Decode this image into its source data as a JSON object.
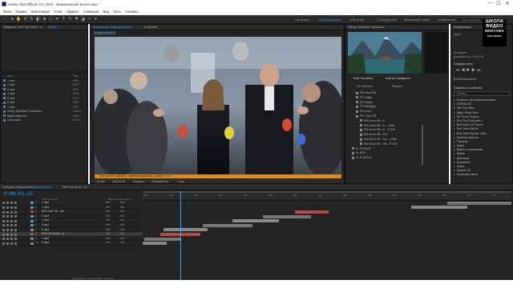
{
  "window": {
    "title": "Adobe After Effects CC 2018 - Безымянный проект.aep *",
    "controls": [
      "—",
      "☐",
      "✕"
    ]
  },
  "menu": [
    "Файл",
    "Правка",
    "Композиция",
    "Слой",
    "Эффект",
    "Анимация",
    "Вид",
    "Окно",
    "Справка"
  ],
  "toolbar": {
    "snap_label": "Привязка",
    "workspaces": [
      "По умолчанию",
      "Обучение",
      "Стандартный",
      "Маленький экран",
      "Библиотеки"
    ],
    "search_placeholder": "Поиск справки"
  },
  "project_panel": {
    "tab_effects": "Эффекты: Dist Pow Zoom - in",
    "tab_project": "Проект",
    "col_name": "Имя",
    "col_type": "Тип",
    "items": [
      {
        "name": "1.mp4",
        "type": "MP4"
      },
      {
        "name": "2.mp4",
        "type": "MP4"
      },
      {
        "name": "3.mp4",
        "type": "MP4"
      },
      {
        "name": "4.mp4",
        "type": "MP4"
      },
      {
        "name": "5.mp4",
        "type": "MP4"
      },
      {
        "name": "6.mp4",
        "type": "MP4"
      },
      {
        "name": "7.mp4",
        "type": "MP4"
      },
      {
        "name": "Handy Seamless Transitions",
        "type": "Папка"
      },
      {
        "name": "Видеоэффекты",
        "type": "Комп."
      },
      {
        "name": "Сплошные",
        "type": "Папка"
      }
    ]
  },
  "viewer": {
    "tab_comp": "Композиция: Видеоэффекты",
    "tab_layer": "Слой (нет)",
    "comp_label": "Видеоэффекты",
    "warning": "Этот проект содержит ошибки выражений: ошибка 1 из 1",
    "zoom": "49,9%",
    "timecode": "0:00:01:15",
    "quality": "Четверть",
    "camera": "Активная ка...",
    "views": "1 вид"
  },
  "extension_panel": {
    "title": "Handy Seamless Transitions",
    "add_transition": "Add Transition",
    "add_by_categories": "Add by Categories",
    "col_no_selected": "No Selected",
    "col_random": "Random",
    "tree": [
      {
        "label": "PR Long Roll",
        "depth": 1
      },
      {
        "label": "PR Shake",
        "depth": 1
      },
      {
        "label": "PR Simple",
        "depth": 1
      },
      {
        "label": "PR Swinging",
        "depth": 1
      },
      {
        "label": "PR Zoom",
        "depth": 1
      },
      {
        "label": "PR Zoom HB",
        "depth": 1
      },
      {
        "label": "Rdl Zoom HB - In",
        "depth": 2
      },
      {
        "label": "Rdl Zoom HB - In - L Roll",
        "depth": 2
      },
      {
        "label": "Rdl Zoom HB - In - R Roll",
        "depth": 2
      },
      {
        "label": "Rdl Zoom HB - Out",
        "depth": 2
      },
      {
        "label": "Rdl Zoom HB - Out - L Roll",
        "depth": 2
      },
      {
        "label": "Rdl Zoom HB - Out - R Roll",
        "depth": 2
      },
      {
        "label": "SL FOLIATE",
        "depth": 0
      },
      {
        "label": "SL BOX",
        "depth": 0
      },
      {
        "label": "SL ELASTIC",
        "depth": 0
      }
    ]
  },
  "info_panel": {
    "tab_info": "Информация",
    "tab_audio": "Аудио",
    "cursor_label": "Последнее",
    "duration_label": "Длительность: 0:00:01:00",
    "preview_label": "Предпросмотр",
    "libraries_label": "Библиотеки ветки",
    "effects_label": "Эффекты и шаблоны",
    "effects_search": "Пример",
    "effects_list": [
      "Шаблоны настройки анимации",
      "CINEMA 4D",
      "Film Emulation",
      "Magic Bullet Suite",
      "RE:Vision Plug-ins",
      "Red Giant Denoiser II",
      "Red Giant LUT Buddy",
      "Red Giant MisFire",
      "Red Giant Shooter Suite",
      "Synthetic Aperture",
      "Trapcode",
      "Аудио",
      "Видео с искажением",
      "Время",
      "Имитация",
      "Искажение",
      "Канал",
      "Каналы 3D",
      "Коррекция цвета"
    ]
  },
  "logo": {
    "line1": "ШКОЛА",
    "line2": "ВИДЕО",
    "line3": "МОНТАЖА",
    "line4": "RUSH MEDIA"
  },
  "timeline": {
    "tab_render": "Очередь рендеринга",
    "tab_comp": "Видеоэффекты",
    "tab_effect": "Dist Pow Zoom - in",
    "timecode": "0:00:01:15",
    "col_name": "Имя источника",
    "col_parent": "Родительский элемент",
    "ruler_ticks": [
      "00s",
      "01s",
      "02s",
      "03s",
      "04s",
      "05s",
      "06s",
      "07s",
      "08s",
      "09s",
      "10s",
      "11s",
      "12s",
      "13s",
      "14s"
    ],
    "layers": [
      {
        "num": "1",
        "name": "1.mp4",
        "mode": "Нет",
        "parent": "Нет",
        "color": "#6a8fb5"
      },
      {
        "num": "2",
        "name": "2.mp4",
        "mode": "Нет",
        "parent": "Нет",
        "color": "#6a8fb5"
      },
      {
        "num": "3",
        "name": "Rdl Zoom HB - Out",
        "mode": "Нет",
        "parent": "Нет",
        "color": "#c0463e"
      },
      {
        "num": "4",
        "name": "3.mp4",
        "mode": "Нет",
        "parent": "Нет",
        "color": "#6a8fb5"
      },
      {
        "num": "5",
        "name": "4.mp4",
        "mode": "Нет",
        "parent": "Нет",
        "color": "#6a8fb5"
      },
      {
        "num": "6",
        "name": "5.mp4",
        "mode": "Нет",
        "parent": "Нет",
        "color": "#6a8fb5"
      },
      {
        "num": "7",
        "name": "6.mp4",
        "mode": "Нет",
        "parent": "Нет",
        "color": "#6a8fb5"
      },
      {
        "num": "8",
        "name": "Dist Pow Zoom - in",
        "mode": "Нет",
        "parent": "Нет",
        "color": "#c0463e"
      },
      {
        "num": "9",
        "name": "7.mp4",
        "mode": "Нет",
        "parent": "Нет",
        "color": "#6a8fb5"
      },
      {
        "num": "10",
        "name": "6.mp4",
        "mode": "Нет",
        "parent": "Нет",
        "color": "#6a8fb5"
      }
    ],
    "footer": "Переключить выключатели / режимы"
  }
}
